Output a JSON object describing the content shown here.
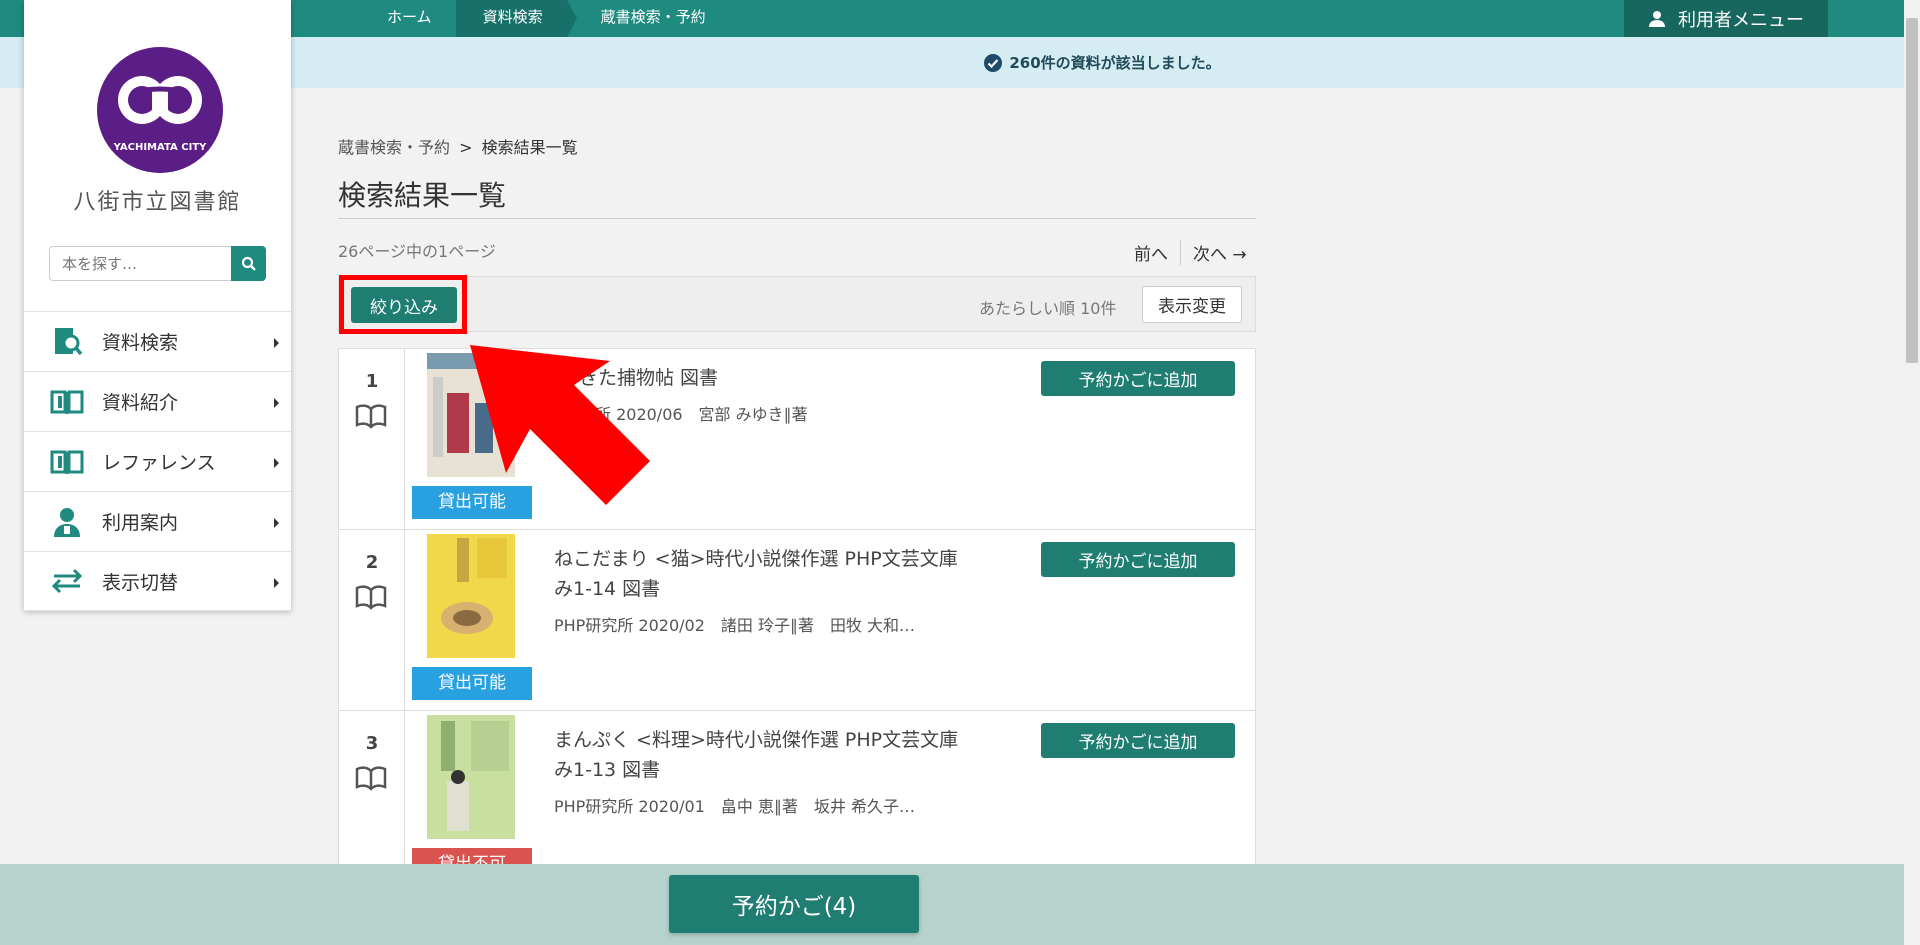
{
  "topnav": {
    "crumbs": [
      {
        "label": "ホーム"
      },
      {
        "label": "資料検索"
      },
      {
        "label": "蔵書検索・予約"
      }
    ],
    "user_menu_label": "利用者メニュー"
  },
  "info": {
    "message": "260件の資料が該当しました。"
  },
  "sidebar": {
    "logo_text": "YACHIMATA CITY",
    "library_name": "八街市立図書館",
    "search_placeholder": "本を探す…",
    "items": [
      {
        "label": "資料検索",
        "icon": "book-search-icon"
      },
      {
        "label": "資料紹介",
        "icon": "open-book-icon"
      },
      {
        "label": "レファレンス",
        "icon": "open-book-icon"
      },
      {
        "label": "利用案内",
        "icon": "librarian-icon"
      },
      {
        "label": "表示切替",
        "icon": "switch-arrows-icon"
      }
    ]
  },
  "main": {
    "breadcrumb": {
      "parent": "蔵書検索・予約",
      "separator": ">",
      "current": "検索結果一覧"
    },
    "title": "検索結果一覧",
    "page_info": "26ページ中の1ページ",
    "pager": {
      "prev": "前へ",
      "next": "次へ →"
    },
    "toolbar": {
      "filter_label": "絞り込み",
      "sort_label": "あたらしい順 10件",
      "display_label": "表示変更"
    },
    "results": [
      {
        "num": "1",
        "title": "きた捕物帖 図書",
        "meta": "究所 2020/06　宮部 みゆき∥著",
        "status": "貸出可能",
        "status_type": "ok",
        "add_label": "予約かごに追加",
        "cover_color": "#e8e2d4",
        "cover_accent": "#7a9ab0"
      },
      {
        "num": "2",
        "title": "ねこだまり <猫>時代小説傑作選 PHP文芸文庫 み1-14 図書",
        "meta": "PHP研究所 2020/02　諸田 玲子∥著　田牧 大和…",
        "status": "貸出可能",
        "status_type": "ok",
        "add_label": "予約かごに追加",
        "cover_color": "#f0d84a",
        "cover_accent": "#c9a640"
      },
      {
        "num": "3",
        "title": "まんぷく <料理>時代小説傑作選 PHP文芸文庫 み1-13 図書",
        "meta": "PHP研究所 2020/01　畠中 恵∥著　坂井 希久子…",
        "status": "貸出不可",
        "status_type": "ng",
        "add_label": "予約かごに追加",
        "cover_color": "#c8dfa0",
        "cover_accent": "#8fb070"
      }
    ]
  },
  "bottom": {
    "cart_label": "予約かご(4)"
  }
}
